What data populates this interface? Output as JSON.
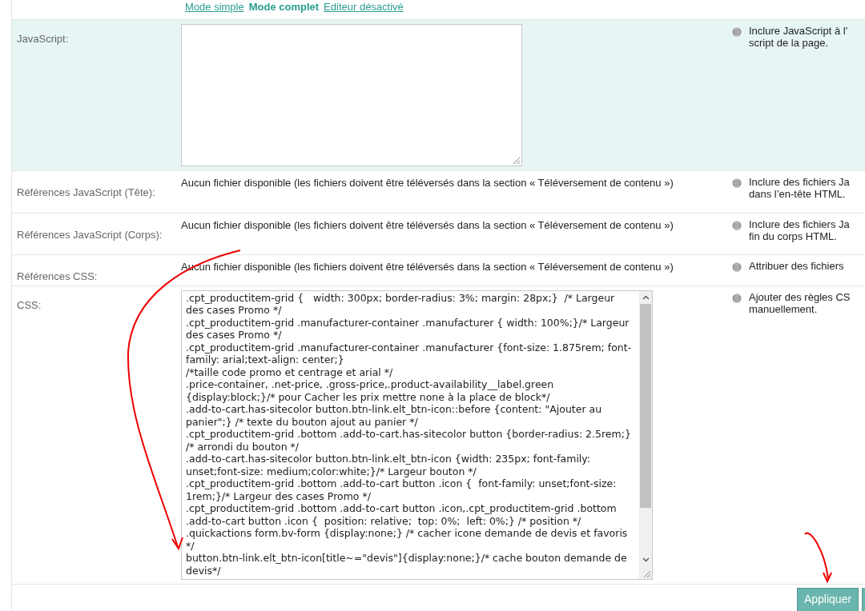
{
  "mode_links": [
    {
      "label": "Mode simple",
      "selected": false
    },
    {
      "label": "Mode complet",
      "selected": true
    },
    {
      "label": "Editeur désactivé",
      "selected": false
    }
  ],
  "rows": [
    {
      "kind": "script",
      "label": "JavaScript:",
      "highlighted": true,
      "help": [
        "Inclure JavaScript à l'",
        "script de la page."
      ]
    },
    {
      "kind": "files",
      "label": "Références JavaScript (Tête):",
      "highlighted": false,
      "value": "Aucun fichier disponible (les fichiers doivent être téléversés dans la section « Téléversement de contenu »)",
      "help": [
        "Inclure des fichiers Ja",
        "dans l’en-tête HTML."
      ]
    },
    {
      "kind": "files",
      "label": "Références JavaScript (Corps):",
      "highlighted": false,
      "value": "Aucun fichier disponible (les fichiers doivent être téléversés dans la section « Téléversement de contenu »)",
      "help": [
        "Inclure des fichiers Ja",
        "fin du corps HTML."
      ]
    },
    {
      "kind": "files",
      "label": "Références CSS:",
      "highlighted": false,
      "value": "Aucun fichier disponible (les fichiers doivent être téléversés dans la section « Téléversement de contenu »)",
      "help": [
        "Attribuer des fichiers"
      ]
    },
    {
      "kind": "style",
      "label": "CSS:",
      "highlighted": false,
      "help": [
        "Ajouter des règles CS",
        "manuellement."
      ],
      "lines": [
        ".cpt_productitem-grid {   width: 300px; border-radius: 3%; margin: 28px;}  /* Largeur des cases Promo */",
        ".cpt_productitem-grid .manufacturer-container .manufacturer { width: 100%;}/* Largeur des cases Promo */",
        ".cpt_productitem-grid .manufacturer-container .manufacturer {font-size: 1.875rem; font-family: arial;text-align: center;}",
        "/*taille code promo et centrage et arial */",
        ".price-container, .net-price, .gross-price,.product-availability__label.green {display:block;}/* pour Cacher les prix mettre none à la place de block*/",
        ".add-to-cart.has-sitecolor button.btn-link.elt_btn-icon::before {content: \"Ajouter au panier\";} /* texte du bouton ajout au panier */",
        ".cpt_productitem-grid .bottom .add-to-cart.has-sitecolor button {border-radius: 2.5rem;} /* arrondi du bouton */",
        ".add-to-cart.has-sitecolor button.btn-link.elt_btn-icon {width: 235px; font-family: unset;font-size: medium;color:white;}/* Largeur bouton */",
        ".cpt_productitem-grid .bottom .add-to-cart button .icon {  font-family: unset;font-size: 1rem;}/* Largeur des cases Promo */",
        ".cpt_productitem-grid .bottom .add-to-cart button .icon,.cpt_productitem-grid .bottom .add-to-cart button .icon {  position: relative;  top: 0%;  left: 0%;} /* position */",
        ".quickactions form.bv-form {display:none;} /* cacher icone demande de devis et favoris */",
        "button.btn-link.elt_btn-icon[title~=\"devis\"]{display:none;}/* cache bouton demande de devis*/"
      ]
    }
  ],
  "apply_button": "Appliquer"
}
